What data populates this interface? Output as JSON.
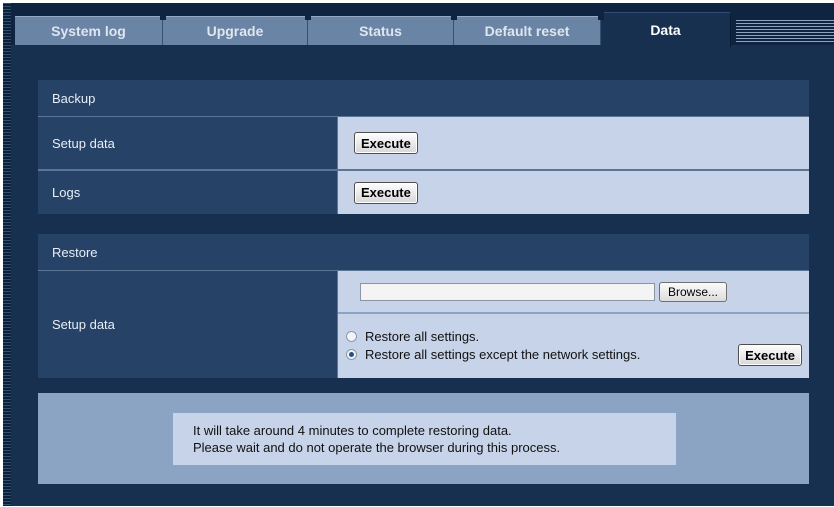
{
  "tabs": [
    {
      "label": "System log",
      "active": false
    },
    {
      "label": "Upgrade",
      "active": false
    },
    {
      "label": "Status",
      "active": false
    },
    {
      "label": "Default reset",
      "active": false
    },
    {
      "label": "Data",
      "active": true
    }
  ],
  "backup": {
    "header": "Backup",
    "setup_data_label": "Setup data",
    "setup_data_button": "Execute",
    "logs_label": "Logs",
    "logs_button": "Execute"
  },
  "restore": {
    "header": "Restore",
    "setup_data_label": "Setup data",
    "file_value": "",
    "browse_button": "Browse...",
    "options": [
      {
        "label": "Restore all settings.",
        "selected": false
      },
      {
        "label": "Restore all settings except the network settings.",
        "selected": true
      }
    ],
    "execute_button": "Execute"
  },
  "notice": {
    "line1": "It will take around 4 minutes to complete restoring data.",
    "line2": "Please wait and do not operate the browser during this process."
  },
  "colors": {
    "background": "#17304f",
    "label_cell": "#264266",
    "value_cell": "#c6d3e8",
    "notice_area": "#8ca4c4"
  }
}
